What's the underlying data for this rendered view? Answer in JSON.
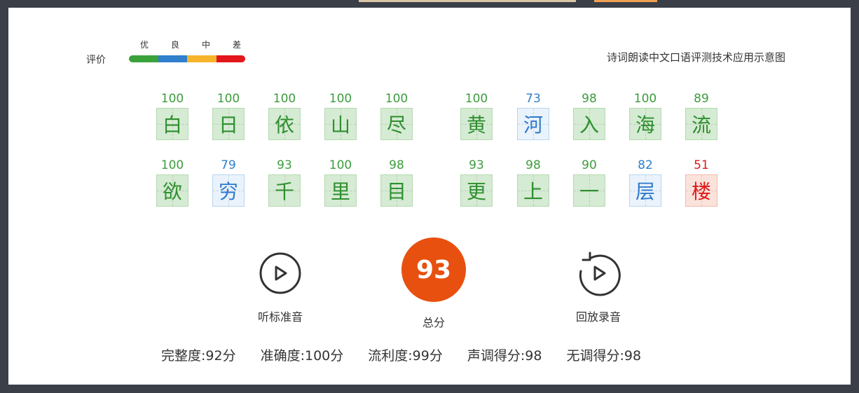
{
  "legend": {
    "label": "评价",
    "grades": [
      "优",
      "良",
      "中",
      "差"
    ],
    "colors": [
      "#3aa23a",
      "#2f7fcc",
      "#f6b42b",
      "#e2161b"
    ]
  },
  "page_title": "诗词朗读中文口语评测技术应用示意图",
  "lines": [
    [
      {
        "char": "白",
        "score": "100",
        "grade": "good"
      },
      {
        "char": "日",
        "score": "100",
        "grade": "good"
      },
      {
        "char": "依",
        "score": "100",
        "grade": "good"
      },
      {
        "char": "山",
        "score": "100",
        "grade": "good"
      },
      {
        "char": "尽",
        "score": "100",
        "grade": "good"
      },
      {
        "char": "黄",
        "score": "100",
        "grade": "good"
      },
      {
        "char": "河",
        "score": "73",
        "grade": "ok"
      },
      {
        "char": "入",
        "score": "98",
        "grade": "good"
      },
      {
        "char": "海",
        "score": "100",
        "grade": "good"
      },
      {
        "char": "流",
        "score": "89",
        "grade": "good"
      }
    ],
    [
      {
        "char": "欲",
        "score": "100",
        "grade": "good"
      },
      {
        "char": "穷",
        "score": "79",
        "grade": "ok"
      },
      {
        "char": "千",
        "score": "93",
        "grade": "good"
      },
      {
        "char": "里",
        "score": "100",
        "grade": "good"
      },
      {
        "char": "目",
        "score": "98",
        "grade": "good"
      },
      {
        "char": "更",
        "score": "93",
        "grade": "good"
      },
      {
        "char": "上",
        "score": "98",
        "grade": "good"
      },
      {
        "char": "一",
        "score": "90",
        "grade": "good"
      },
      {
        "char": "层",
        "score": "82",
        "grade": "ok"
      },
      {
        "char": "楼",
        "score": "51",
        "grade": "bad"
      }
    ]
  ],
  "controls": {
    "play_standard_label": "听标准音",
    "total_label": "总分",
    "total_score": "93",
    "replay_label": "回放录音"
  },
  "stats": {
    "completeness": "完整度:92分",
    "accuracy": "准确度:100分",
    "fluency": "流利度:99分",
    "tone_score": "声调得分:98",
    "toneless_score": "无调得分:98"
  },
  "colors": {
    "total_badge": "#e8500f"
  }
}
